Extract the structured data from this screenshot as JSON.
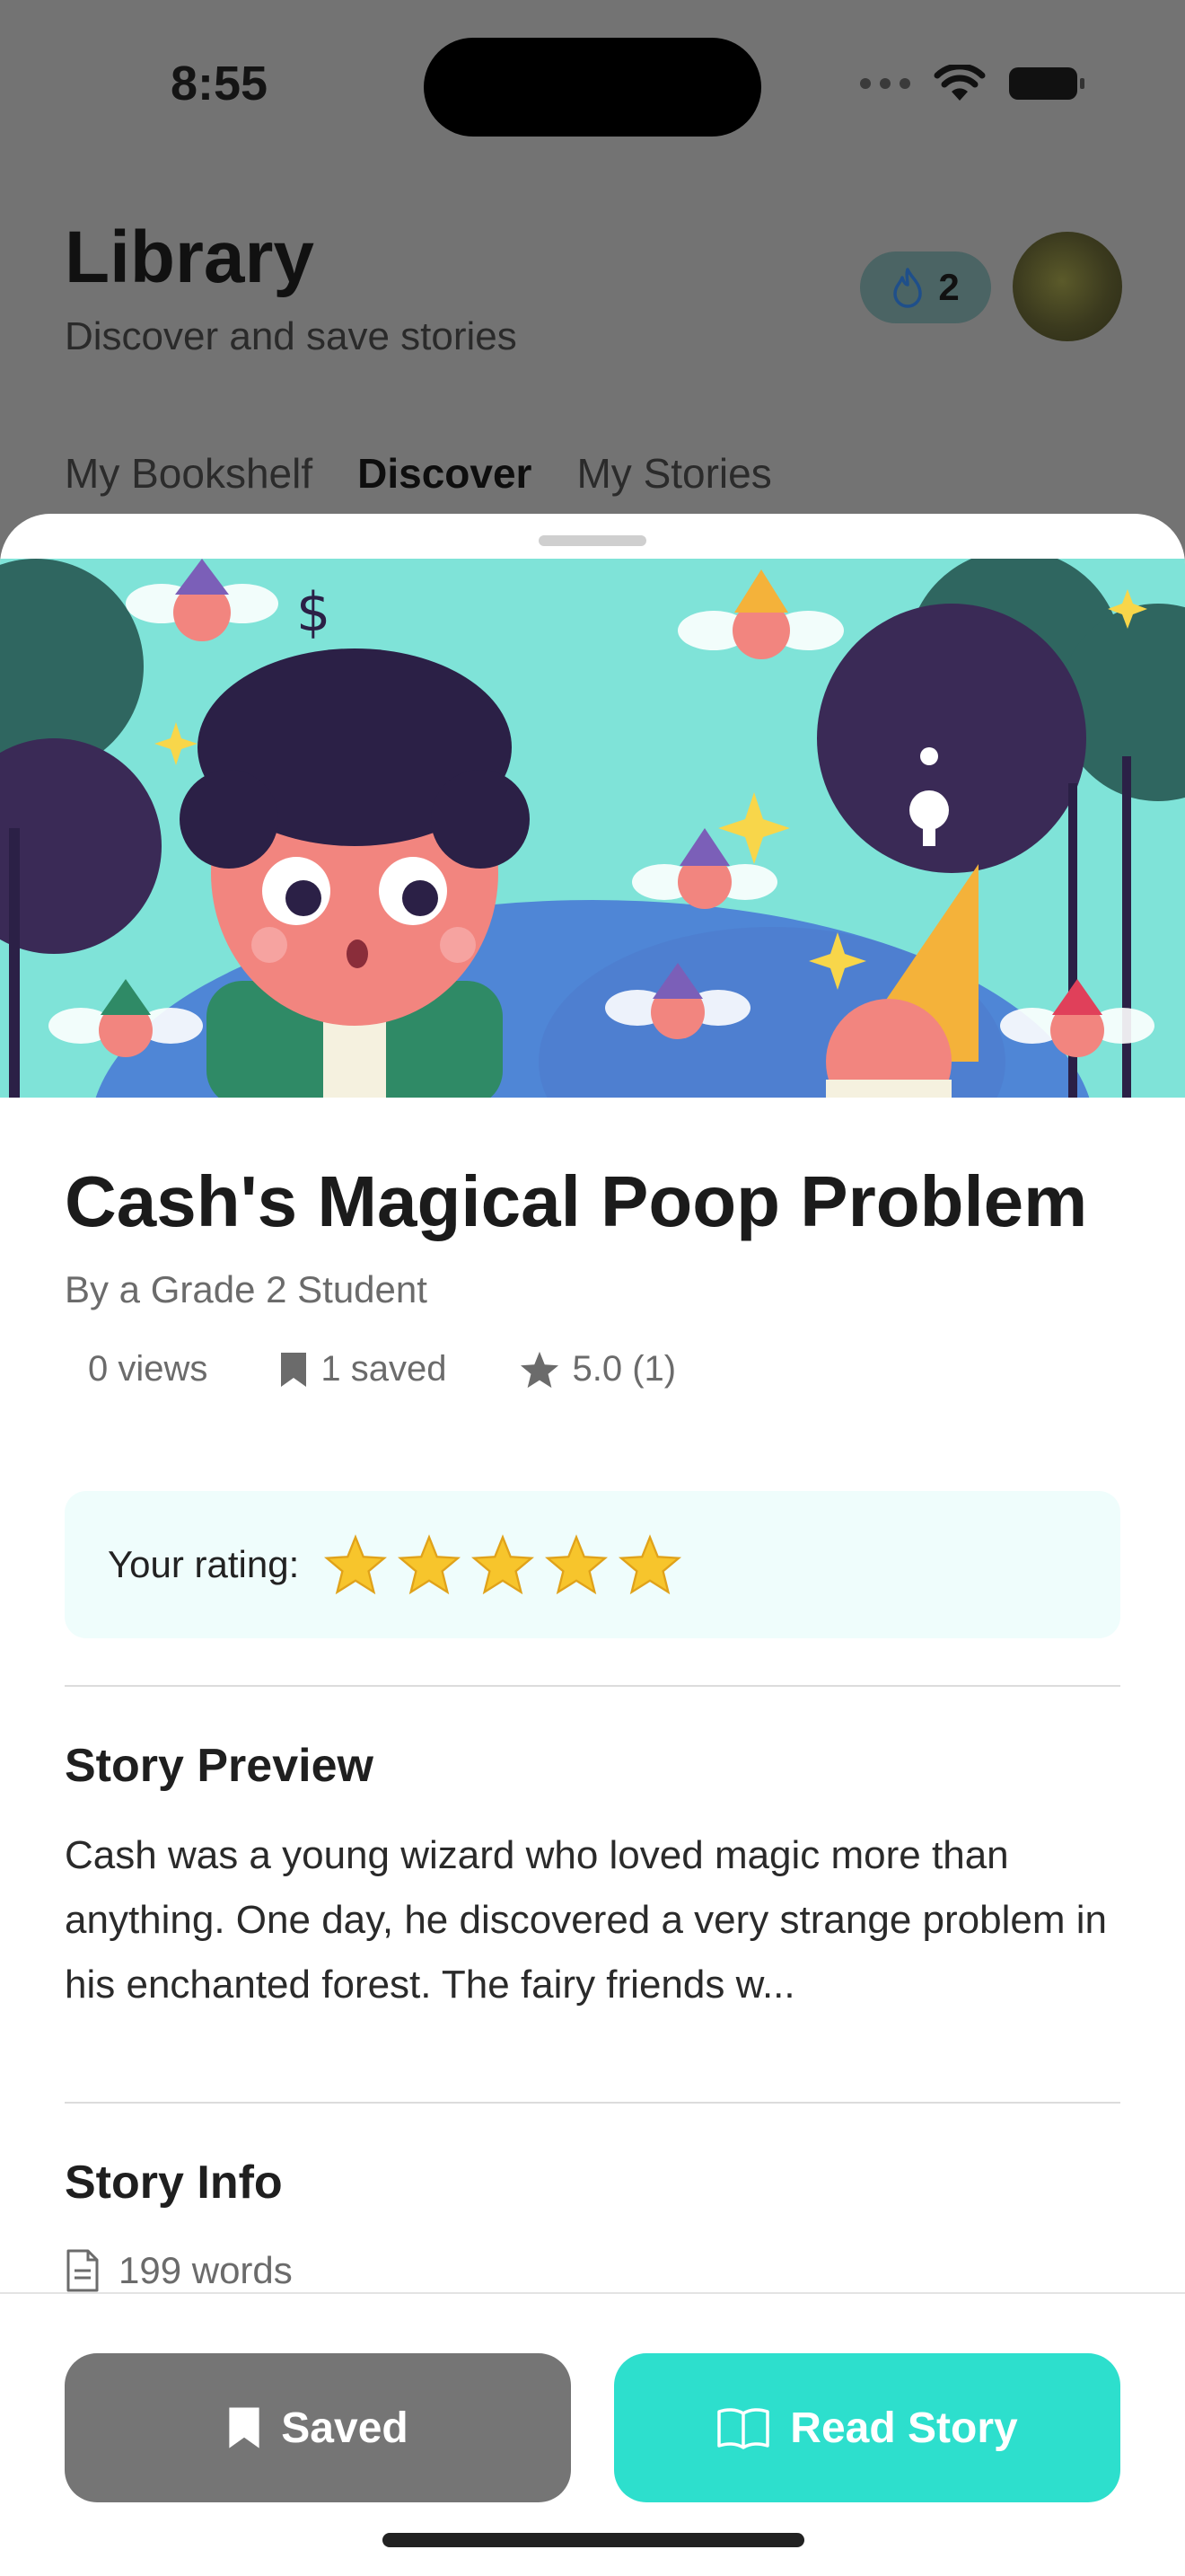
{
  "status_bar": {
    "time": "8:55"
  },
  "header": {
    "title": "Library",
    "subtitle": "Discover and save stories",
    "streak_count": "2"
  },
  "tabs": [
    {
      "label": "My Bookshelf"
    },
    {
      "label": "Discover"
    },
    {
      "label": "My Stories"
    }
  ],
  "story": {
    "title": "Cash's Magical Poop Problem",
    "byline": "By a Grade 2 Student",
    "views": "0 views",
    "saved": "1 saved",
    "rating": "5.0 (1)"
  },
  "your_rating": {
    "label": "Your rating:",
    "stars": 5
  },
  "preview": {
    "title": "Story Preview",
    "text": "Cash was a young wizard who loved magic more than anything. One day, he discovered a very strange problem in his enchanted forest. The fairy friends w..."
  },
  "info": {
    "title": "Story Info",
    "words": "199 words"
  },
  "actions": {
    "saved_label": "Saved",
    "read_label": "Read Story"
  },
  "colors": {
    "accent": "#2ddfcd",
    "saved_button": "#757575",
    "rating_card": "#effdfc"
  },
  "icons": [
    "wifi-icon",
    "battery-icon",
    "flame-icon",
    "bookmark-icon",
    "star-icon",
    "document-icon",
    "book-open-icon"
  ]
}
